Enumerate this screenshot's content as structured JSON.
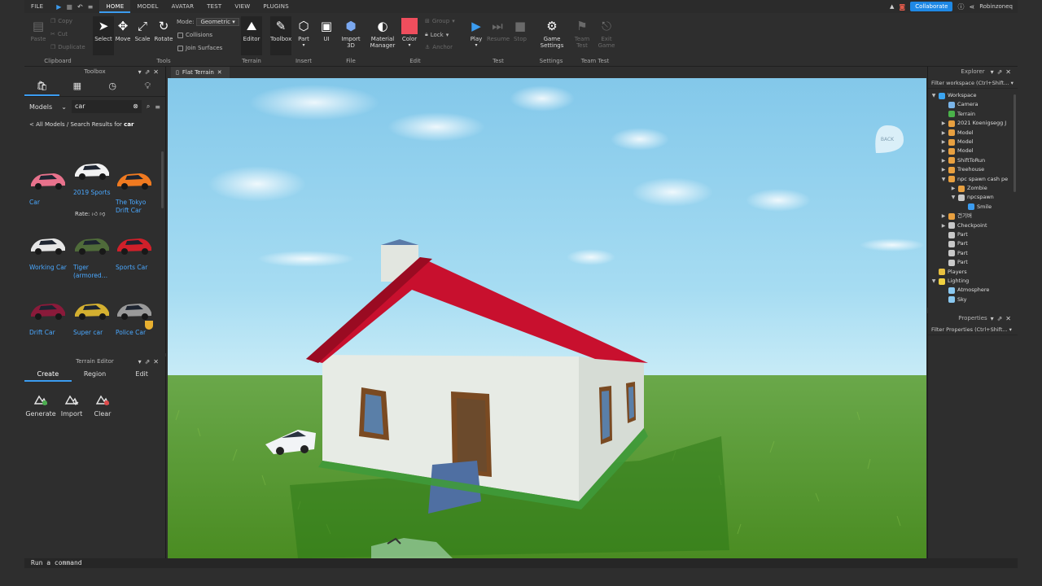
{
  "menubar": {
    "file": "FILE",
    "tabs": [
      "HOME",
      "MODEL",
      "AVATAR",
      "TEST",
      "VIEW",
      "PLUGINS"
    ],
    "active_tab": "HOME",
    "collaborate": "Collaborate",
    "user": "Robinzoneq"
  },
  "ribbon": {
    "clipboard": {
      "paste": "Paste",
      "copy": "Copy",
      "cut": "Cut",
      "duplicate": "Duplicate",
      "label": "Clipboard"
    },
    "tools": {
      "select": "Select",
      "move": "Move",
      "scale": "Scale",
      "rotate": "Rotate",
      "mode_label": "Mode:",
      "mode_value": "Geometric",
      "collisions": "Collisions",
      "join_surfaces": "Join Surfaces",
      "label": "Tools"
    },
    "terrain": {
      "editor": "Editor",
      "label": "Terrain"
    },
    "insert": {
      "toolbox": "Toolbox",
      "part": "Part",
      "ui": "UI",
      "label": "Insert"
    },
    "file": {
      "import3d_1": "Import",
      "import3d_2": "3D",
      "label": "File"
    },
    "edit": {
      "material_1": "Material",
      "material_2": "Manager",
      "color": "Color",
      "group": "Group",
      "lock": "Lock",
      "anchor": "Anchor",
      "label": "Edit"
    },
    "test": {
      "play": "Play",
      "resume": "Resume",
      "stop": "Stop",
      "label": "Test"
    },
    "settings": {
      "game_1": "Game",
      "game_2": "Settings",
      "label": "Settings"
    },
    "teamtest": {
      "team_1": "Team",
      "team_2": "Test",
      "exit_1": "Exit",
      "exit_2": "Game",
      "label": "Team Test"
    }
  },
  "toolbox": {
    "title": "Toolbox",
    "category": "Models",
    "query": "car",
    "crumb_prefix": "< All Models / Search Results for ",
    "crumb_term": "car",
    "rate_label": "Rate:",
    "models": [
      {
        "name": "Car",
        "name2": "",
        "color": "#e8728c"
      },
      {
        "name": "2019 Sports",
        "name2": "",
        "color": "#f2f2f2"
      },
      {
        "name": "The Tokyo",
        "name2": "Drift Car",
        "color": "#f07a20"
      },
      {
        "name": "Working Car",
        "name2": "",
        "color": "#e6e6e6"
      },
      {
        "name": "Tiger",
        "name2": "(armored…",
        "color": "#4f6b3a"
      },
      {
        "name": "Sports Car",
        "name2": "",
        "color": "#d0202a"
      },
      {
        "name": "Drift Car",
        "name2": "",
        "color": "#8a1a3a"
      },
      {
        "name": "Super car",
        "name2": "",
        "color": "#d4b030"
      },
      {
        "name": "Police Car",
        "name2": "",
        "color": "#9a9a9a"
      }
    ]
  },
  "terrain_editor": {
    "title": "Terrain Editor",
    "tabs": [
      "Create",
      "Region",
      "Edit"
    ],
    "active_tab": "Create",
    "tools": [
      "Generate",
      "Import",
      "Clear"
    ]
  },
  "document": {
    "tab": "Flat Terrain"
  },
  "viewport": {
    "back_label": "BACK"
  },
  "explorer": {
    "title": "Explorer",
    "filter": "Filter workspace (Ctrl+Shift...",
    "items": [
      {
        "label": "Workspace",
        "depth": 0,
        "arrow": "▼",
        "icon": "#3ba4f0"
      },
      {
        "label": "Camera",
        "depth": 1,
        "arrow": "",
        "icon": "#7ab4e8"
      },
      {
        "label": "Terrain",
        "depth": 1,
        "arrow": "",
        "icon": "#4ab24a"
      },
      {
        "label": "2021 Koenigsegg J",
        "depth": 1,
        "arrow": "▶",
        "icon": "#e8a040"
      },
      {
        "label": "Model",
        "depth": 1,
        "arrow": "▶",
        "icon": "#e8a040"
      },
      {
        "label": "Model",
        "depth": 1,
        "arrow": "▶",
        "icon": "#e8a040"
      },
      {
        "label": "Model",
        "depth": 1,
        "arrow": "▶",
        "icon": "#e8a040"
      },
      {
        "label": "ShiftToRun",
        "depth": 1,
        "arrow": "▶",
        "icon": "#e8a040"
      },
      {
        "label": "Treehouse",
        "depth": 1,
        "arrow": "▶",
        "icon": "#e8a040"
      },
      {
        "label": "npc spawn cash pe",
        "depth": 1,
        "arrow": "▼",
        "icon": "#e8a040"
      },
      {
        "label": "Zombie",
        "depth": 2,
        "arrow": "▶",
        "icon": "#e8a040"
      },
      {
        "label": "npcspawn",
        "depth": 2,
        "arrow": "▼",
        "icon": "#c8c8c8"
      },
      {
        "label": "Smile",
        "depth": 3,
        "arrow": "",
        "icon": "#3b9cf0"
      },
      {
        "label": "건기버",
        "depth": 1,
        "arrow": "▶",
        "icon": "#e8a040"
      },
      {
        "label": "Checkpoint",
        "depth": 1,
        "arrow": "▶",
        "icon": "#c8c8c8"
      },
      {
        "label": "Part",
        "depth": 1,
        "arrow": "",
        "icon": "#c8c8c8"
      },
      {
        "label": "Part",
        "depth": 1,
        "arrow": "",
        "icon": "#c8c8c8"
      },
      {
        "label": "Part",
        "depth": 1,
        "arrow": "",
        "icon": "#c8c8c8"
      },
      {
        "label": "Part",
        "depth": 1,
        "arrow": "",
        "icon": "#c8c8c8"
      },
      {
        "label": "Players",
        "depth": 0,
        "arrow": "",
        "icon": "#e8c040"
      },
      {
        "label": "Lighting",
        "depth": 0,
        "arrow": "▼",
        "icon": "#f0d040"
      },
      {
        "label": "Atmosphere",
        "depth": 1,
        "arrow": "",
        "icon": "#8ac8f0"
      },
      {
        "label": "Sky",
        "depth": 1,
        "arrow": "",
        "icon": "#8ac8f0"
      }
    ]
  },
  "properties": {
    "title": "Properties",
    "filter": "Filter Properties (Ctrl+Shift..."
  },
  "command": {
    "placeholder": "Run a command"
  },
  "colors": {
    "accent": "#3b9cf0",
    "roof": "#c8102e",
    "wall": "#e8ece8",
    "grass": "#4f9a2a",
    "sky": "#8fd2ee"
  }
}
